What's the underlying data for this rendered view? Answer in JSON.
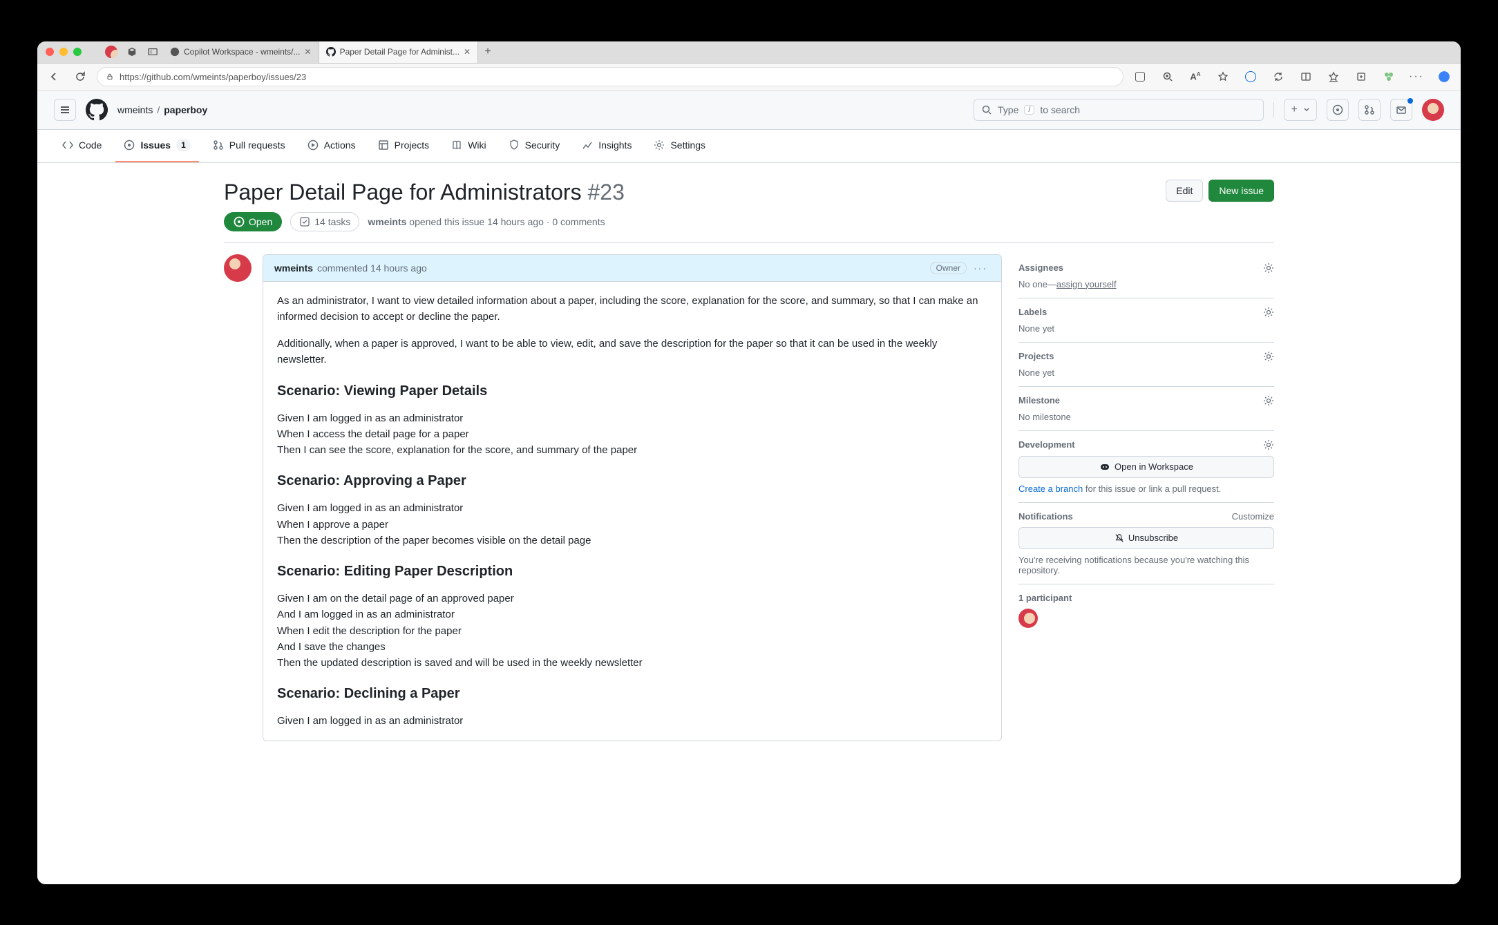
{
  "browser": {
    "tabs": [
      {
        "label": "Copilot Workspace - wmeints/...",
        "active": false
      },
      {
        "label": "Paper Detail Page for Administ...",
        "active": true
      }
    ],
    "url": "https://github.com/wmeints/paperboy/issues/23"
  },
  "repo": {
    "owner": "wmeints",
    "name": "paperboy"
  },
  "search": {
    "prefix": "Type",
    "key": "/",
    "suffix": "to search"
  },
  "nav": {
    "code": "Code",
    "issues": "Issues",
    "issues_count": "1",
    "pulls": "Pull requests",
    "actions": "Actions",
    "projects": "Projects",
    "wiki": "Wiki",
    "security": "Security",
    "insights": "Insights",
    "settings": "Settings"
  },
  "issue": {
    "title": "Paper Detail Page for Administrators",
    "number": "#23",
    "edit": "Edit",
    "new": "New issue",
    "state": "Open",
    "tasks": "14 tasks",
    "author": "wmeints",
    "opened": "opened this issue 14 hours ago",
    "comments": "0 comments"
  },
  "comment": {
    "author": "wmeints",
    "when": "commented 14 hours ago",
    "badge": "Owner",
    "p1": "As an administrator, I want to view detailed information about a paper, including the score, explanation for the score, and summary, so that I can make an informed decision to accept or decline the paper.",
    "p2": "Additionally, when a paper is approved, I want to be able to view, edit, and save the description for the paper so that it can be used in the weekly newsletter.",
    "s1h": "Scenario: Viewing Paper Details",
    "s1a": "Given I am logged in as an administrator",
    "s1b": "When I access the detail page for a paper",
    "s1c": "Then I can see the score, explanation for the score, and summary of the paper",
    "s2h": "Scenario: Approving a Paper",
    "s2a": "Given I am logged in as an administrator",
    "s2b": "When I approve a paper",
    "s2c": "Then the description of the paper becomes visible on the detail page",
    "s3h": "Scenario: Editing Paper Description",
    "s3a": "Given I am on the detail page of an approved paper",
    "s3b": "And I am logged in as an administrator",
    "s3c": "When I edit the description for the paper",
    "s3d": "And I save the changes",
    "s3e": "Then the updated description is saved and will be used in the weekly newsletter",
    "s4h": "Scenario: Declining a Paper",
    "s4a": "Given I am logged in as an administrator"
  },
  "sidebar": {
    "assignees": {
      "title": "Assignees",
      "text": "No one—",
      "link": "assign yourself"
    },
    "labels": {
      "title": "Labels",
      "text": "None yet"
    },
    "projects": {
      "title": "Projects",
      "text": "None yet"
    },
    "milestone": {
      "title": "Milestone",
      "text": "No milestone"
    },
    "development": {
      "title": "Development",
      "open": "Open in Workspace",
      "create": "Create a branch",
      "rest": " for this issue or link a pull request."
    },
    "notifications": {
      "title": "Notifications",
      "customize": "Customize",
      "unsubscribe": "Unsubscribe",
      "note": "You're receiving notifications because you're watching this repository."
    },
    "participants": {
      "title": "1 participant"
    }
  }
}
